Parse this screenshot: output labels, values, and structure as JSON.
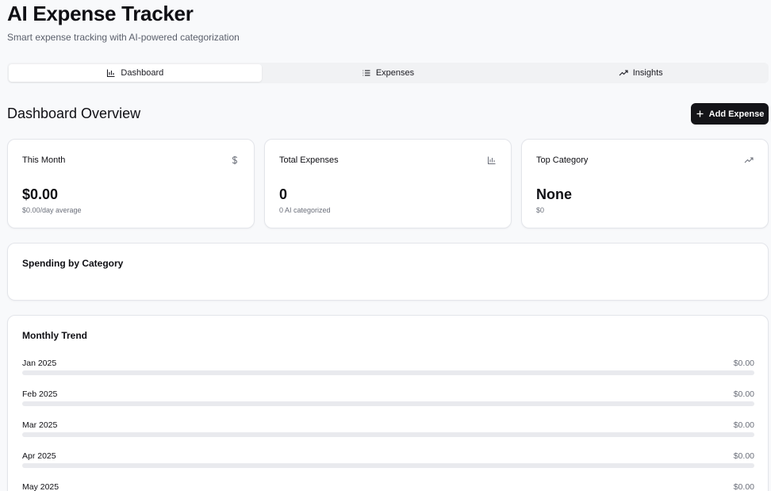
{
  "header": {
    "title": "AI Expense Tracker",
    "subtitle": "Smart expense tracking with AI-powered categorization"
  },
  "tabs": [
    {
      "label": "Dashboard",
      "icon": "bar-chart-icon",
      "active": true
    },
    {
      "label": "Expenses",
      "icon": "list-icon",
      "active": false
    },
    {
      "label": "Insights",
      "icon": "trending-up-icon",
      "active": false
    }
  ],
  "dashboard": {
    "title": "Dashboard Overview",
    "add_button_label": "Add Expense"
  },
  "stats": [
    {
      "label": "This Month",
      "value": "$0.00",
      "sub": "$0.00/day average",
      "icon": "dollar-icon"
    },
    {
      "label": "Total Expenses",
      "value": "0",
      "sub": "0 AI categorized",
      "icon": "bar-chart-icon"
    },
    {
      "label": "Top Category",
      "value": "None",
      "sub": "$0",
      "icon": "trending-up-icon"
    }
  ],
  "spending": {
    "title": "Spending by Category"
  },
  "trend": {
    "title": "Monthly Trend",
    "months": [
      {
        "label": "Jan 2025",
        "amount": "$0.00",
        "progress": 0
      },
      {
        "label": "Feb 2025",
        "amount": "$0.00",
        "progress": 0
      },
      {
        "label": "Mar 2025",
        "amount": "$0.00",
        "progress": 0
      },
      {
        "label": "Apr 2025",
        "amount": "$0.00",
        "progress": 0
      },
      {
        "label": "May 2025",
        "amount": "$0.00",
        "progress": 0
      }
    ]
  },
  "colors": {
    "background": "#f8f9fb",
    "primary": "#141418",
    "muted_text": "#6b6f7a",
    "border": "#e3e5ea",
    "bar_track": "#e9eaee"
  }
}
